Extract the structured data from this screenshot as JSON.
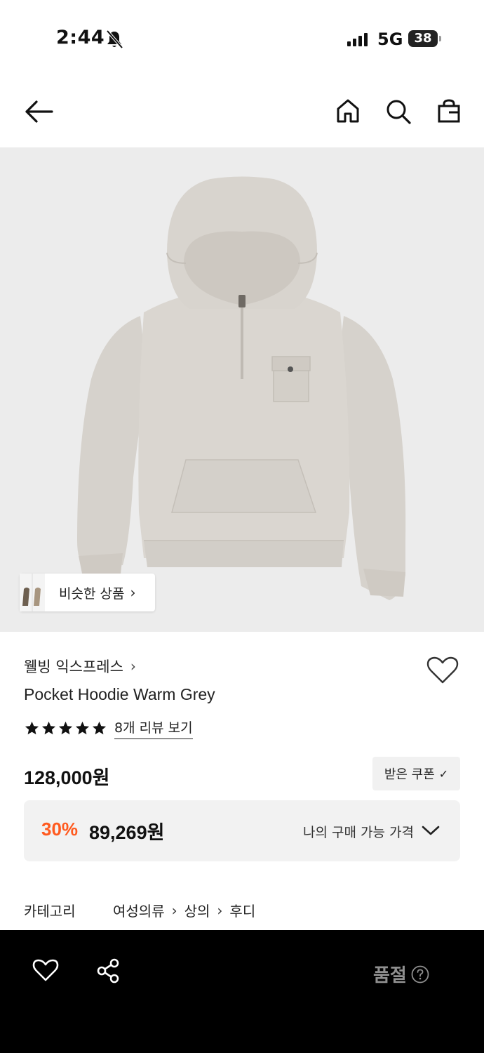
{
  "status_bar": {
    "time": "2:44",
    "network": "5G",
    "battery": "38"
  },
  "header": {
    "back_icon": "arrow-left-icon",
    "home_icon": "home-icon",
    "search_icon": "search-icon",
    "cart_icon": "shopping-bag-icon"
  },
  "product_image": {
    "similar_products_label": "비슷한 상품"
  },
  "product": {
    "brand": "웰빙 익스프레스",
    "name": "Pocket Hoodie Warm Grey",
    "rating_stars": 5,
    "review_link": "8개 리뷰 보기",
    "price": "128,000원",
    "coupon_button": "받은 쿠폰",
    "discount_rate": "30%",
    "discount_price": "89,269원",
    "my_price_label": "나의 구매 가능 가격"
  },
  "category": {
    "label": "카테고리",
    "path": [
      "여성의류",
      "상의",
      "후디"
    ]
  },
  "bottom_bar": {
    "soldout_label": "품절"
  },
  "colors": {
    "accent_discount": "#ff5a1f",
    "bottom_bar_bg": "#000000",
    "image_bg": "#ececec",
    "hoodie": "#d9d5cf"
  }
}
